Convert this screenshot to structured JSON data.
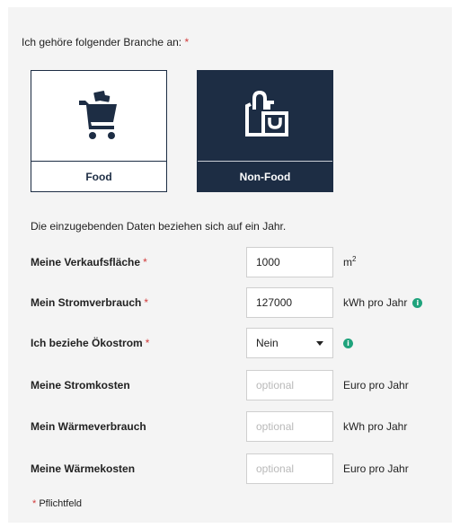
{
  "branche": {
    "label": "Ich gehöre folgender Branche an:",
    "required_mark": "*",
    "options": [
      {
        "label": "Food",
        "icon": "shopping-cart-icon",
        "selected": false
      },
      {
        "label": "Non-Food",
        "icon": "shopping-bag-icon",
        "selected": true
      }
    ]
  },
  "intro_text": "Die einzugebenden Daten beziehen sich auf ein Jahr.",
  "fields": {
    "verkaufsflaeche": {
      "label": "Meine Verkaufsfläche",
      "required": "*",
      "value": "1000",
      "unit": "m",
      "unit_sup": "2"
    },
    "stromverbrauch": {
      "label": "Mein Stromverbrauch",
      "required": "*",
      "value": "127000",
      "unit": "kWh pro Jahr",
      "info_icon": "info-icon"
    },
    "oekostrom": {
      "label": "Ich beziehe Ökostrom",
      "required": "*",
      "value": "Nein",
      "info_icon": "info-icon"
    },
    "stromkosten": {
      "label": "Meine Stromkosten",
      "placeholder": "optional",
      "unit": "Euro pro Jahr"
    },
    "waermeverbrauch": {
      "label": "Mein Wärmeverbrauch",
      "placeholder": "optional",
      "unit": "kWh pro Jahr"
    },
    "waermekosten": {
      "label": "Meine Wärmekosten",
      "placeholder": "optional",
      "unit": "Euro pro Jahr"
    }
  },
  "footnote": {
    "mark": "*",
    "text": "Pflichtfeld"
  },
  "colors": {
    "navy": "#1d2d44",
    "required": "#d13b3b",
    "info": "#1fa37c",
    "panel": "#f4f4f4"
  }
}
